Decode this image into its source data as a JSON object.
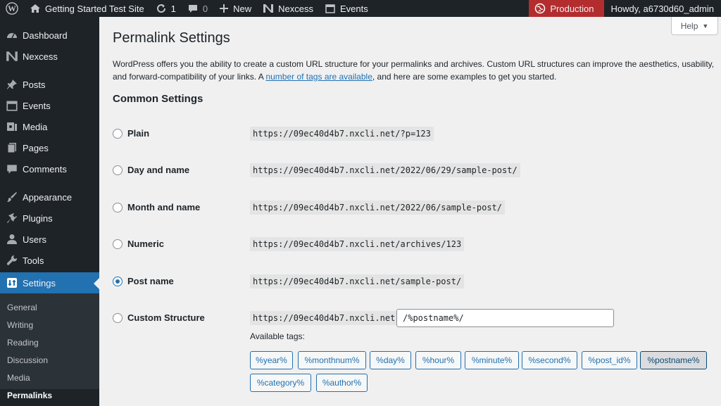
{
  "adminbar": {
    "site_name": "Getting Started Test Site",
    "updates_count": "1",
    "comments_count": "0",
    "new_label": "New",
    "nexcess_label": "Nexcess",
    "events_label": "Events",
    "production_label": "Production",
    "howdy": "Howdy, a6730d60_admin"
  },
  "sidebar": {
    "items": [
      {
        "label": "Dashboard",
        "icon": "dashboard-icon"
      },
      {
        "label": "Nexcess",
        "icon": "nexcess-icon"
      },
      {
        "label": "Posts",
        "icon": "pin-icon"
      },
      {
        "label": "Events",
        "icon": "calendar-icon"
      },
      {
        "label": "Media",
        "icon": "media-icon"
      },
      {
        "label": "Pages",
        "icon": "pages-icon"
      },
      {
        "label": "Comments",
        "icon": "comment-icon"
      },
      {
        "label": "Appearance",
        "icon": "brush-icon"
      },
      {
        "label": "Plugins",
        "icon": "plugin-icon"
      },
      {
        "label": "Users",
        "icon": "user-icon"
      },
      {
        "label": "Tools",
        "icon": "wrench-icon"
      },
      {
        "label": "Settings",
        "icon": "settings-icon"
      }
    ],
    "submenu": [
      "General",
      "Writing",
      "Reading",
      "Discussion",
      "Media",
      "Permalinks"
    ]
  },
  "help_label": "Help",
  "page": {
    "title": "Permalink Settings",
    "intro_before": "WordPress offers you the ability to create a custom URL structure for your permalinks and archives. Custom URL structures can improve the aesthetics, usability, and forward-compatibility of your links. A ",
    "intro_link": "number of tags are available",
    "intro_after": ", and here are some examples to get you started.",
    "common_heading": "Common Settings"
  },
  "options": [
    {
      "label": "Plain",
      "example": "https://09ec40d4b7.nxcli.net/?p=123",
      "checked": false
    },
    {
      "label": "Day and name",
      "example": "https://09ec40d4b7.nxcli.net/2022/06/29/sample-post/",
      "checked": false
    },
    {
      "label": "Month and name",
      "example": "https://09ec40d4b7.nxcli.net/2022/06/sample-post/",
      "checked": false
    },
    {
      "label": "Numeric",
      "example": "https://09ec40d4b7.nxcli.net/archives/123",
      "checked": false
    },
    {
      "label": "Post name",
      "example": "https://09ec40d4b7.nxcli.net/sample-post/",
      "checked": true
    },
    {
      "label": "Custom Structure",
      "example": "https://09ec40d4b7.nxcli.net",
      "checked": false
    }
  ],
  "custom_structure_value": "/%postname%/",
  "available_tags_label": "Available tags:",
  "tags": [
    "%year%",
    "%monthnum%",
    "%day%",
    "%hour%",
    "%minute%",
    "%second%",
    "%post_id%",
    "%postname%",
    "%category%",
    "%author%"
  ],
  "active_tag": "%postname%",
  "colors": {
    "accent": "#2271b1",
    "adminbar": "#1d2327",
    "production": "#b32d2e"
  }
}
